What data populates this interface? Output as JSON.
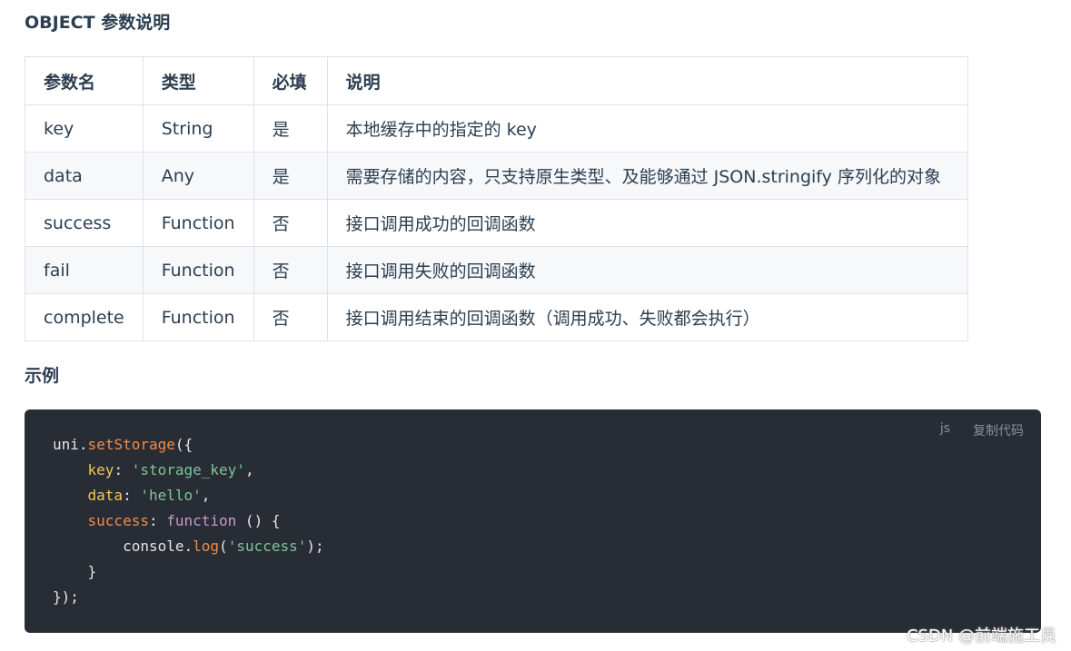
{
  "object_title": "OBJECT 参数说明",
  "table": {
    "headers": [
      "参数名",
      "类型",
      "必填",
      "说明"
    ],
    "rows": [
      [
        "key",
        "String",
        "是",
        "本地缓存中的指定的 key"
      ],
      [
        "data",
        "Any",
        "是",
        "需要存储的内容，只支持原生类型、及能够通过 JSON.stringify 序列化的对象"
      ],
      [
        "success",
        "Function",
        "否",
        "接口调用成功的回调函数"
      ],
      [
        "fail",
        "Function",
        "否",
        "接口调用失败的回调函数"
      ],
      [
        "complete",
        "Function",
        "否",
        "接口调用结束的回调函数（调用成功、失败都会执行）"
      ]
    ]
  },
  "example_title": "示例",
  "code": {
    "lang": "js",
    "copy_label": "复制代码",
    "l1_obj": "uni",
    "l1_dot": ".",
    "l1_fn": "setStorage",
    "l1_rest": "({",
    "l2_key": "key",
    "l2_colon": ": ",
    "l2_str": "'storage_key'",
    "l2_end": ",",
    "l3_key": "data",
    "l3_colon": ": ",
    "l3_str": "'hello'",
    "l3_end": ",",
    "l4_key": "success",
    "l4_colon": ": ",
    "l4_kw": "function",
    "l4_rest": " () {",
    "l5_obj": "console",
    "l5_dot": ".",
    "l5_fn": "log",
    "l5_open": "(",
    "l5_str": "'success'",
    "l5_close": ");",
    "l6": "}",
    "l7": "});"
  },
  "watermark": "CSDN @前端施工员"
}
